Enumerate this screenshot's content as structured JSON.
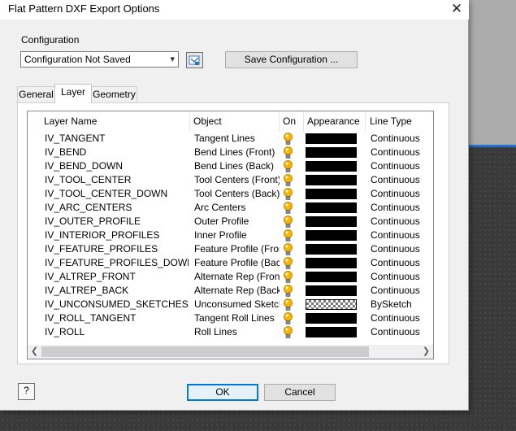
{
  "window": {
    "title": "Flat Pattern DXF Export Options"
  },
  "configuration": {
    "label": "Configuration",
    "selected": "Configuration Not Saved",
    "save_button": "Save Configuration ..."
  },
  "tabs": [
    {
      "label": "General",
      "active": false
    },
    {
      "label": "Layer",
      "active": true
    },
    {
      "label": "Geometry",
      "active": false
    }
  ],
  "table": {
    "columns": [
      "Layer Name",
      "Object",
      "On",
      "Appearance",
      "Line Type"
    ],
    "rows": [
      {
        "layer": "IV_TANGENT",
        "object": "Tangent Lines",
        "on": true,
        "appearance": "solid-black",
        "line_type": "Continuous"
      },
      {
        "layer": "IV_BEND",
        "object": "Bend Lines (Front)",
        "on": true,
        "appearance": "solid-black",
        "line_type": "Continuous"
      },
      {
        "layer": "IV_BEND_DOWN",
        "object": "Bend Lines (Back)",
        "on": true,
        "appearance": "solid-black",
        "line_type": "Continuous"
      },
      {
        "layer": "IV_TOOL_CENTER",
        "object": "Tool Centers (Front)",
        "on": true,
        "appearance": "solid-black",
        "line_type": "Continuous"
      },
      {
        "layer": "IV_TOOL_CENTER_DOWN",
        "object": "Tool Centers (Back)",
        "on": true,
        "appearance": "solid-black",
        "line_type": "Continuous"
      },
      {
        "layer": "IV_ARC_CENTERS",
        "object": "Arc Centers",
        "on": true,
        "appearance": "solid-black",
        "line_type": "Continuous"
      },
      {
        "layer": "IV_OUTER_PROFILE",
        "object": "Outer Profile",
        "on": true,
        "appearance": "solid-black",
        "line_type": "Continuous"
      },
      {
        "layer": "IV_INTERIOR_PROFILES",
        "object": "Inner Profile",
        "on": true,
        "appearance": "solid-black",
        "line_type": "Continuous"
      },
      {
        "layer": "IV_FEATURE_PROFILES",
        "object": "Feature Profile (Front)",
        "on": true,
        "appearance": "solid-black",
        "line_type": "Continuous"
      },
      {
        "layer": "IV_FEATURE_PROFILES_DOWN",
        "object": "Feature Profile (Back)",
        "on": true,
        "appearance": "solid-black",
        "line_type": "Continuous"
      },
      {
        "layer": "IV_ALTREP_FRONT",
        "object": "Alternate Rep (Front)",
        "on": true,
        "appearance": "solid-black",
        "line_type": "Continuous"
      },
      {
        "layer": "IV_ALTREP_BACK",
        "object": "Alternate Rep (Back)",
        "on": true,
        "appearance": "solid-black",
        "line_type": "Continuous"
      },
      {
        "layer": "IV_UNCONSUMED_SKETCHES",
        "object": "Unconsumed Sketches",
        "on": true,
        "appearance": "checker",
        "line_type": "BySketch"
      },
      {
        "layer": "IV_ROLL_TANGENT",
        "object": "Tangent Roll Lines",
        "on": true,
        "appearance": "solid-black",
        "line_type": "Continuous"
      },
      {
        "layer": "IV_ROLL",
        "object": "Roll Lines",
        "on": true,
        "appearance": "solid-black",
        "line_type": "Continuous"
      }
    ]
  },
  "buttons": {
    "ok": "OK",
    "cancel": "Cancel",
    "help_icon": "?"
  },
  "icons": {
    "close": "close-icon",
    "browse": "browse-folder-icon",
    "on": "lightbulb-icon",
    "help": "help-icon",
    "combo": "chevron-down-icon",
    "scroll_left": "scroll-left-arrow-icon",
    "scroll_right": "scroll-right-arrow-icon"
  },
  "colors": {
    "dialog_bg": "#f0f0f0",
    "accent": "#0078d7",
    "bulb": "#f7b500",
    "appearance_solid": "#000000"
  }
}
